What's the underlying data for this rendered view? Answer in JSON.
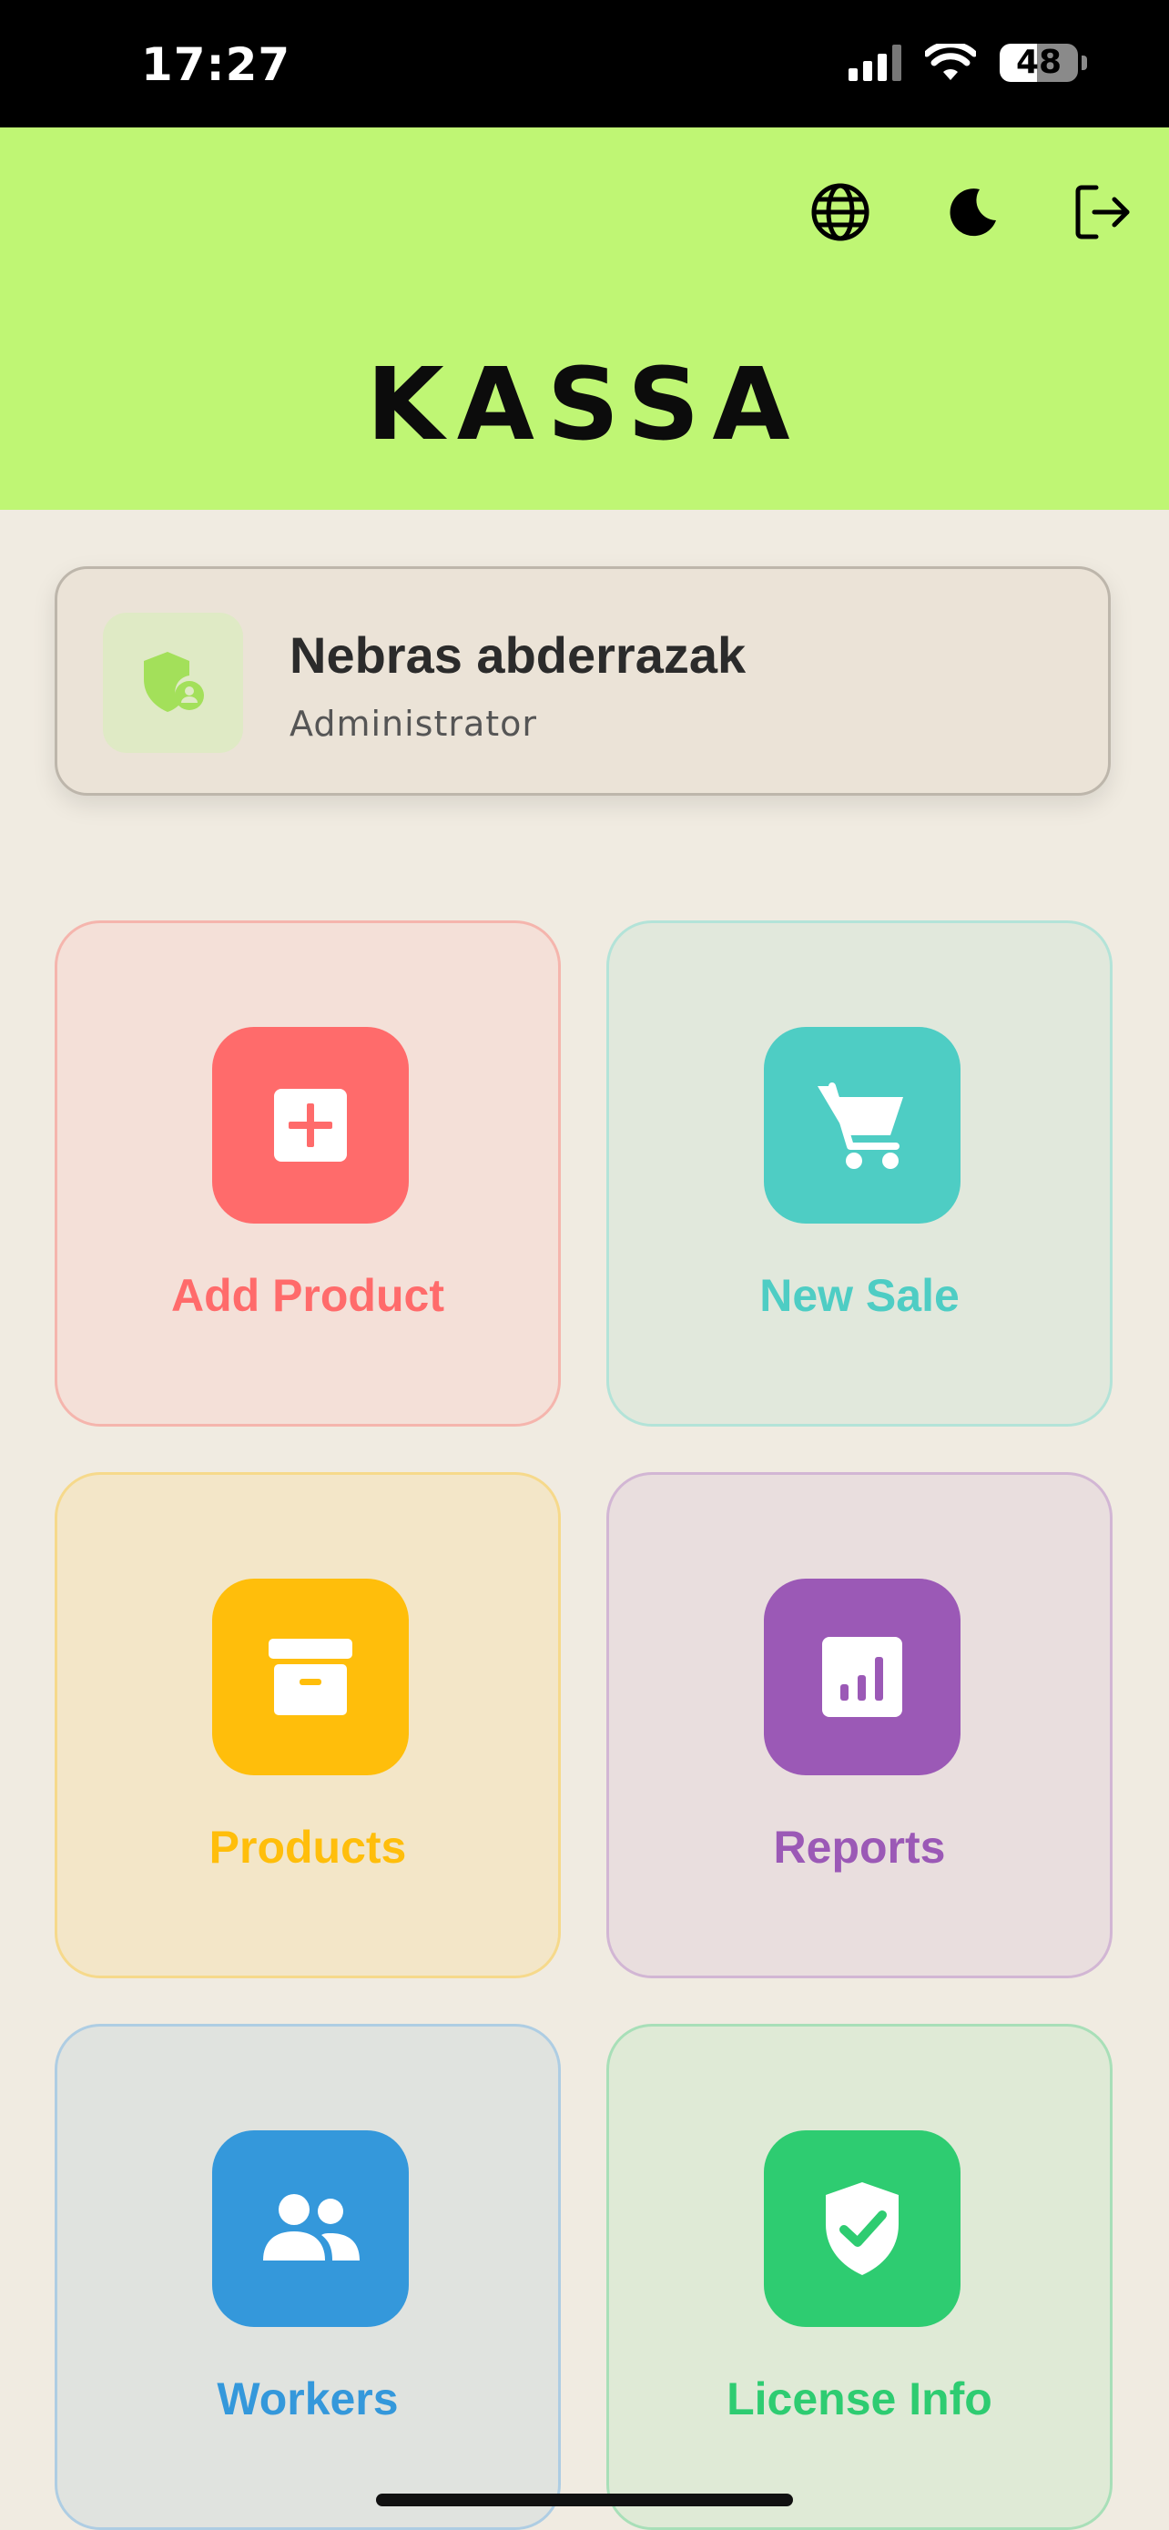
{
  "status": {
    "time": "17:27",
    "battery": "48",
    "battery_level": 0.48
  },
  "header": {
    "title": "KASSA",
    "icons": [
      "globe-icon",
      "moon-icon",
      "logout-icon"
    ]
  },
  "user": {
    "name": "Nebras abderrazak",
    "role": "Administrator",
    "icon": "shield-user-icon"
  },
  "tiles": [
    {
      "label": "Add Product",
      "icon": "add-box-icon",
      "color": "#ff6b6b",
      "bg": "#f4e0d8",
      "border": "#f5b5ad"
    },
    {
      "label": "New Sale",
      "icon": "cart-icon",
      "color": "#4ecdc4",
      "bg": "#e1e8dc",
      "border": "#b3e3d8"
    },
    {
      "label": "Products",
      "icon": "archive-icon",
      "color": "#ffbe0b",
      "bg": "#f3e6c8",
      "border": "#f6d98b"
    },
    {
      "label": "Reports",
      "icon": "chart-icon",
      "color": "#9b59b6",
      "bg": "#e9dede",
      "border": "#d2b6d4"
    },
    {
      "label": "Workers",
      "icon": "users-icon",
      "color": "#3498db",
      "bg": "#e0e3df",
      "border": "#aecde3"
    },
    {
      "label": "License Info",
      "icon": "shield-check-icon",
      "color": "#2ecc71",
      "bg": "#dfead6",
      "border": "#a8dfb8"
    }
  ]
}
